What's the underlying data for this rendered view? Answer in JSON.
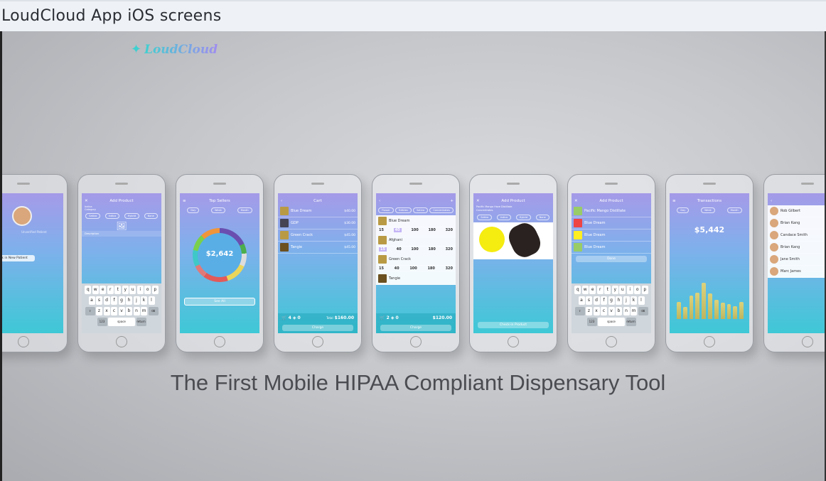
{
  "page": {
    "title": "LoudCloud App iOS screens"
  },
  "video": {
    "logo": "LoudCloud",
    "tagline": "The First Mobile HIPAA Compliant Dispensary Tool",
    "colors": {
      "screen_top": "#a59ae8",
      "screen_bottom": "#3ec8d6",
      "logo": "#3fd0d0"
    },
    "phones": {
      "patient": {
        "status": "Unverified Patient",
        "button": "Check in New Patient",
        "tabs": [
          "$"
        ]
      },
      "add1": {
        "title": "Add Product",
        "field1": "Indica",
        "field2": "Category",
        "pills": [
          "Sativa",
          "Indica",
          "Hybrid",
          "None"
        ],
        "desc": "Description"
      },
      "top": {
        "title": "Top Sellers",
        "pills": [
          "Day",
          "Week",
          "Month"
        ],
        "total": "$2,642",
        "button": "See All"
      },
      "cart": {
        "title": "Cart",
        "items": [
          {
            "name": "Blue Dream",
            "price": "$40.00"
          },
          {
            "name": "GDP",
            "price": "$30.00"
          },
          {
            "name": "Green Crack",
            "price": "$45.00"
          },
          {
            "name": "Tangie",
            "price": "$45.00"
          }
        ],
        "count": "4",
        "coupons": "0",
        "total_label": "Total",
        "total": "$160.00",
        "button": "Charge"
      },
      "menu": {
        "pills": [
          "Flower",
          "Edibles",
          "Sativa",
          "Concentrates"
        ],
        "items": [
          {
            "name": "Blue Dream",
            "nums": [
              "15",
              "40",
              "100",
              "180",
              "320"
            ]
          },
          {
            "name": "Afghani",
            "nums": [
              "15",
              "40",
              "100",
              "180",
              "320"
            ]
          },
          {
            "name": "Green Crack",
            "nums": [
              "15",
              "40",
              "100",
              "180",
              "320"
            ]
          },
          {
            "name": "Tangie"
          }
        ],
        "count": "2",
        "coupons": "0",
        "total": "$120.00",
        "button": "Charge"
      },
      "add2": {
        "title": "Add Product",
        "name": "Pacific Mango Haze Distillate",
        "type": "Concentrates",
        "pills": [
          "Sativa",
          "Indica",
          "Hybrid",
          "None"
        ],
        "button": "Check-in Product"
      },
      "add3": {
        "title": "Add Product",
        "items": [
          "Pacific Mango Distillate",
          "Blue Dream",
          "Blue Dream",
          "Blue Dream"
        ],
        "button": "Done"
      },
      "trans": {
        "title": "Transactions",
        "pills": [
          "Day",
          "Week",
          "Month"
        ],
        "total": "$5,442",
        "bars": [
          40,
          28,
          55,
          62,
          85,
          60,
          45,
          38,
          35,
          30,
          40
        ]
      },
      "contacts": {
        "names": [
          "Rob Gilbert",
          "Brian Kang",
          "Candace Smith",
          "Brian Kang",
          "Jane Smith",
          "Marc James"
        ]
      }
    },
    "keyboard": {
      "rows": [
        [
          "q",
          "w",
          "e",
          "r",
          "t",
          "y",
          "u",
          "i",
          "o",
          "p"
        ],
        [
          "a",
          "s",
          "d",
          "f",
          "g",
          "h",
          "j",
          "k",
          "l"
        ],
        [
          "z",
          "x",
          "c",
          "v",
          "b",
          "n",
          "m"
        ]
      ],
      "space": "space",
      "return": "return",
      "num": "123"
    }
  }
}
